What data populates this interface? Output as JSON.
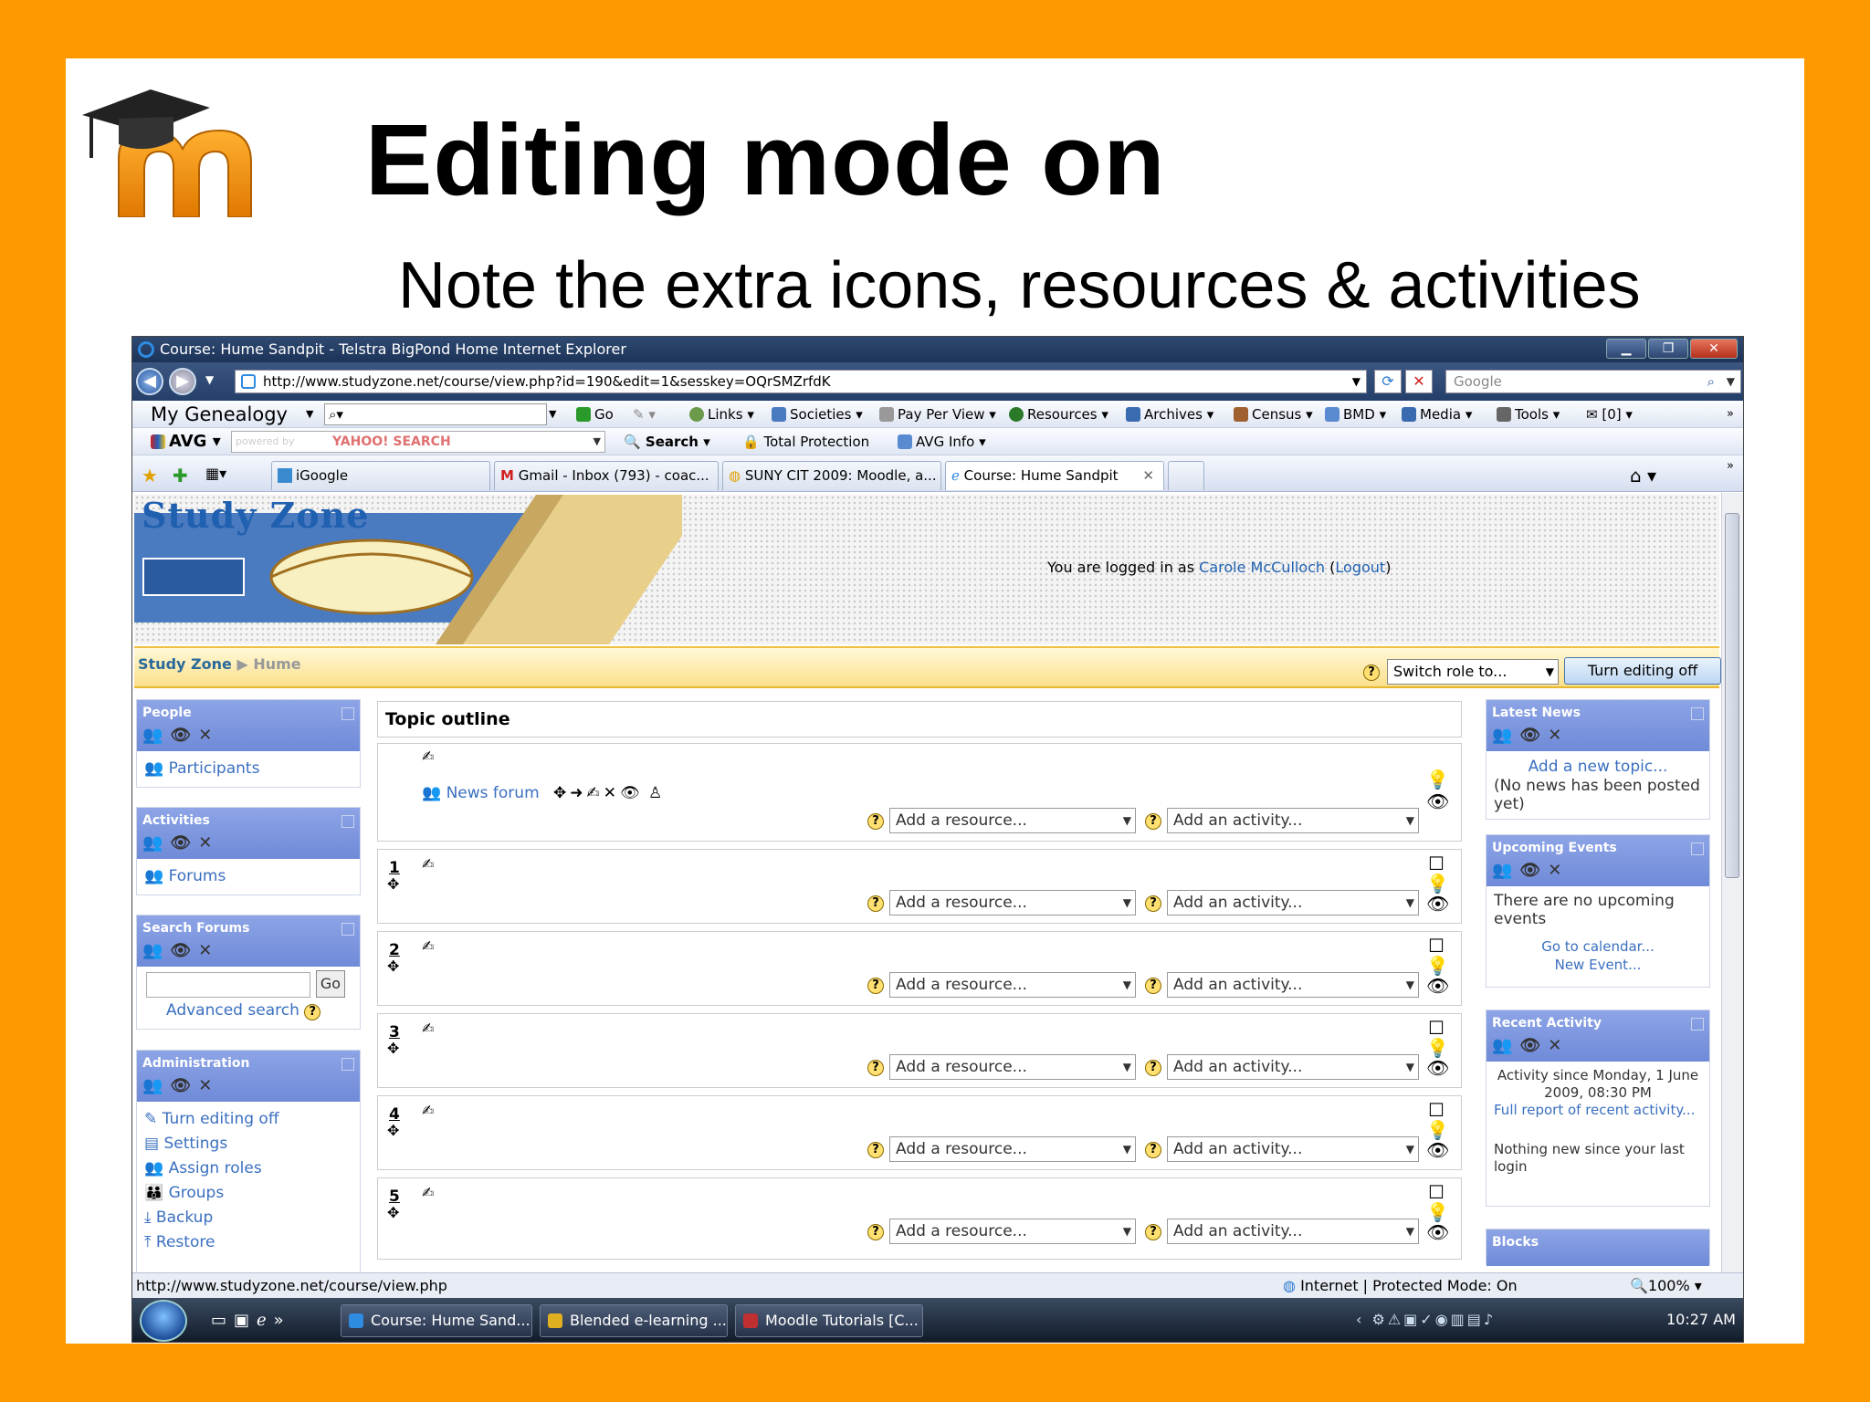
{
  "slide": {
    "title": "Editing mode on",
    "subtitle": "Note the extra icons, resources & activities"
  },
  "window": {
    "title": "Course: Hume Sandpit - Telstra BigPond Home Internet Explorer",
    "url": "http://www.studyzone.net/course/view.php?id=190&edit=1&sesskey=OQrSMZrfdK",
    "search_placeholder": "Google"
  },
  "toolbar1": {
    "genealogy": "My Genealogy",
    "go": "Go",
    "links": "Links",
    "societies": "Societies",
    "payperview": "Pay Per View",
    "resources": "Resources",
    "archives": "Archives",
    "census": "Census",
    "bmd": "BMD",
    "media": "Media",
    "tools": "Tools",
    "mail_count": "[0]"
  },
  "toolbar2": {
    "avg": "AVG",
    "yahoo": "YAHOO! SEARCH",
    "powered": "powered by",
    "search": "Search",
    "total_protection": "Total Protection",
    "avg_info": "AVG Info"
  },
  "tabs": [
    {
      "label": "iGoogle"
    },
    {
      "label": "Gmail - Inbox (793) - coac..."
    },
    {
      "label": "SUNY CIT 2009: Moodle, a..."
    },
    {
      "label": "Course: Hume Sandpit"
    }
  ],
  "moodle": {
    "site_name": "Study Zone",
    "logged_in_prefix": "You are logged in as",
    "user": "Carole McCulloch",
    "logout": "Logout",
    "crumb_home": "Study Zone",
    "crumb_sep": "▶",
    "crumb_course": "Hume",
    "switch_role": "Switch role to...",
    "turn_editing_off": "Turn editing off",
    "topic_outline": "Topic outline",
    "news_forum": "News forum",
    "add_resource": "Add a resource...",
    "add_activity": "Add an activity..."
  },
  "left_blocks": {
    "people": {
      "title": "People",
      "items": [
        "Participants"
      ]
    },
    "activities": {
      "title": "Activities",
      "items": [
        "Forums"
      ]
    },
    "search_forums": {
      "title": "Search Forums",
      "go": "Go",
      "advanced": "Advanced search"
    },
    "administration": {
      "title": "Administration",
      "items": [
        "Turn editing off",
        "Settings",
        "Assign roles",
        "Groups",
        "Backup",
        "Restore"
      ]
    }
  },
  "right_blocks": {
    "latest_news": {
      "title": "Latest News",
      "add": "Add a new topic...",
      "note": "(No news has been posted yet)"
    },
    "upcoming": {
      "title": "Upcoming Events",
      "note": "There are no upcoming events",
      "calendar": "Go to calendar...",
      "new_event": "New Event..."
    },
    "recent": {
      "title": "Recent Activity",
      "since": "Activity since Monday, 1 June 2009, 08:30 PM",
      "full": "Full report of recent activity...",
      "nothing": "Nothing new since your last login"
    },
    "blocks": {
      "title": "Blocks"
    }
  },
  "sections": [
    "1",
    "2",
    "3",
    "4",
    "5"
  ],
  "status": {
    "url": "http://www.studyzone.net/course/view.php",
    "zone": "Internet | Protected Mode: On",
    "zoom": "100%"
  },
  "taskbar": {
    "items": [
      "Course: Hume Sand...",
      "Blended e-learning ...",
      "Moodle Tutorials [C..."
    ],
    "time": "10:27 AM"
  }
}
